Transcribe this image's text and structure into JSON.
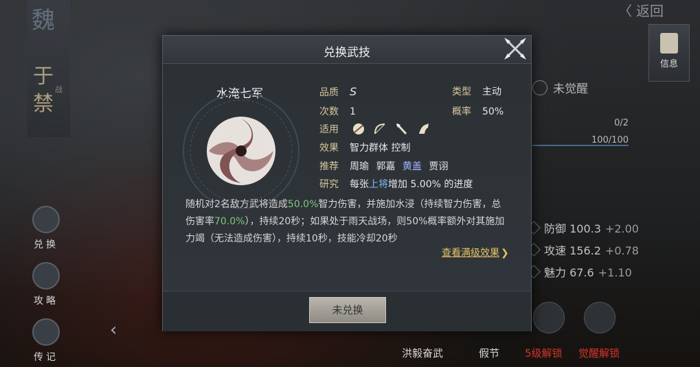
{
  "background": {
    "back_label": "返回",
    "info_label": "信息",
    "banner": {
      "kingdom": "魏",
      "name": "于禁",
      "tag": "战"
    },
    "side_buttons": [
      {
        "label": "兑换"
      },
      {
        "label": "攻略"
      },
      {
        "label": "传记"
      }
    ],
    "awaken_label": "未觉醒",
    "bar1_value": "0/2",
    "bar2_value": "100/100",
    "stats": [
      {
        "label": "防御",
        "value": "100.3",
        "plus": "+2.00"
      },
      {
        "label": "攻速",
        "value": "156.2",
        "plus": "+0.78"
      },
      {
        "label": "魅力",
        "value": "67.6",
        "plus": "+1.10"
      }
    ],
    "bottom_labels": [
      {
        "label": "洪毅奋武",
        "color": "#d6d6d6"
      },
      {
        "label": "假节",
        "color": "#d6d6d6"
      },
      {
        "label": "5级解锁",
        "color": "#d9352b"
      },
      {
        "label": "觉醒解锁",
        "color": "#d9352b"
      }
    ]
  },
  "dialog": {
    "title": "兑换武技",
    "skill_name": "水淹七军",
    "quality_label": "品质",
    "quality_value": "S",
    "type_label": "类型",
    "type_value": "主动",
    "count_label": "次数",
    "count_value": "1",
    "rate_label": "概率",
    "rate_value": "50%",
    "applicable_label": "适用",
    "applicable_icons": [
      "ball-weapon-icon",
      "bow-icon",
      "spear-icon",
      "horse-icon"
    ],
    "effect_label": "效果",
    "effect_value": "智力群体 控制",
    "recommend_label": "推荐",
    "recommend": [
      {
        "name": "周瑜",
        "highlight": false
      },
      {
        "name": "郭嘉",
        "highlight": false
      },
      {
        "name": "黄盖",
        "highlight": true
      },
      {
        "name": "贾诩",
        "highlight": false
      }
    ],
    "research_label": "研究",
    "research_prefix": "每张",
    "research_hl": "上将",
    "research_suffix": "增加 5.00% 的进度",
    "desc_1": "随机对2名敌方武将造成",
    "desc_pct1": "50.0%",
    "desc_2": "智力伤害，并施加水浸（持续智力伤害，总伤害率",
    "desc_pct2": "70.0%",
    "desc_3": "），持续20秒；如果处于雨天战场，则50%概率额外对其施加力竭（无法造成伤害），持续10秒，技能冷却20秒",
    "full_effect_link": "查看满级效果",
    "button_label": "未兑换"
  }
}
